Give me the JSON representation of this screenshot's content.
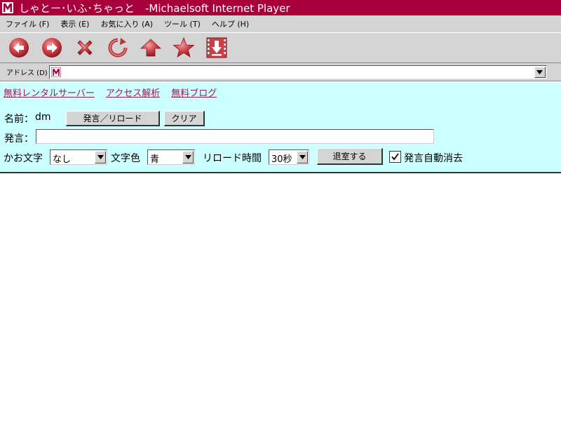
{
  "window": {
    "title": "しゃとー･いふ･ちゃっと　-Michaelsoft Internet Player"
  },
  "menu": [
    "ファイル (F)",
    "表示 (E)",
    "お気に入り (A)",
    "ツール (T)",
    "ヘルプ (H)"
  ],
  "toolbar": {
    "icons": [
      "back-icon",
      "forward-icon",
      "stop-icon",
      "refresh-icon",
      "home-icon",
      "favorites-icon",
      "download-icon"
    ],
    "accent_color": "#c0392b"
  },
  "address": {
    "label": "アドレス (D)",
    "value": ""
  },
  "links": [
    "無料レンタルサーバー",
    "アクセス解析",
    "無料ブログ"
  ],
  "form": {
    "name_label": "名前：",
    "name_value": "dm",
    "post_reload_button": "発言／リロード",
    "clear_button": "クリア",
    "message_label": "発言：",
    "message_value": "",
    "kaomoji_label": "かお文字",
    "kaomoji_value": "なし",
    "color_label": "文字色",
    "color_value": "青",
    "reload_label": "リロード時間",
    "reload_value": "30秒",
    "leave_button": "退室する",
    "auto_clear_checked": true,
    "auto_clear_label": "発言自動消去"
  },
  "colors": {
    "titlebar": "#a8003a",
    "content_bg": "#ccffff",
    "link": "#9b1a55"
  }
}
